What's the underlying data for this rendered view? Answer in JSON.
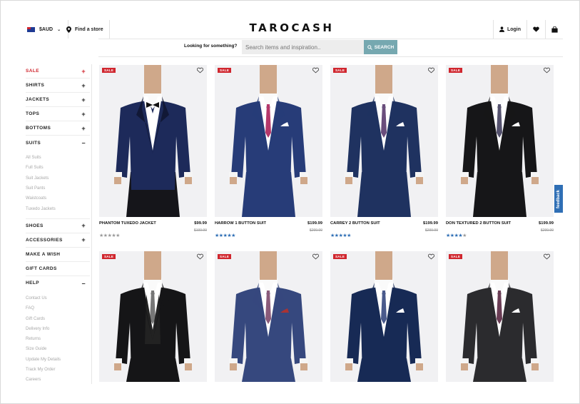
{
  "header": {
    "currency": "$AUD",
    "store_label": "Find a store",
    "logo": "TAROCASH",
    "login_label": "Login"
  },
  "search": {
    "label": "Looking for something?",
    "placeholder": "Search items and inspiration..",
    "button": "SEARCH"
  },
  "sidebar": {
    "sale": "SALE",
    "shirts": "SHIRTS",
    "jackets": "JACKETS",
    "tops": "TOPS",
    "bottoms": "BOTTOMS",
    "suits": "SUITS",
    "suits_sub": [
      "All Suits",
      "Full Suits",
      "Suit Jackets",
      "Suit Pants",
      "Waistcoats",
      "Tuxedo Jackets"
    ],
    "shoes": "SHOES",
    "accessories": "ACCESSORIES",
    "make_a_wish": "MAKE A WISH",
    "gift_cards": "GIFT CARDS",
    "help": "HELP",
    "help_sub": [
      "Contact Us",
      "FAQ",
      "Gift Cards",
      "Delivery Info",
      "Returns",
      "Size Guide",
      "Update My Details",
      "Track My Order",
      "Careers"
    ],
    "plus": "+",
    "minus": "–"
  },
  "products": [
    {
      "badge": "SALE",
      "name": "PHANTOM TUXEDO JACKET",
      "price": "$99.99",
      "old_price": "$199.99",
      "rating": 0
    },
    {
      "badge": "SALE",
      "name": "HARROW 1 BUTTON SUIT",
      "price": "$199.99",
      "old_price": "$299.99",
      "rating": 5
    },
    {
      "badge": "SALE",
      "name": "CARREY 2 BUTTON SUIT",
      "price": "$199.99",
      "old_price": "$299.99",
      "rating": 4.5
    },
    {
      "badge": "SALE",
      "name": "DON TEXTURED 2 BUTTON SUIT",
      "price": "$199.99",
      "old_price": "$299.99",
      "rating": 4
    },
    {
      "badge": "SALE"
    },
    {
      "badge": "SALE"
    },
    {
      "badge": "SALE"
    },
    {
      "badge": "SALE"
    }
  ],
  "feedback": "feedback",
  "colors": {
    "sale_red": "#d0262e",
    "search_btn": "#76a8b0",
    "star_blue": "#2f6fb5",
    "feedback_blue": "#2f6fb5"
  }
}
